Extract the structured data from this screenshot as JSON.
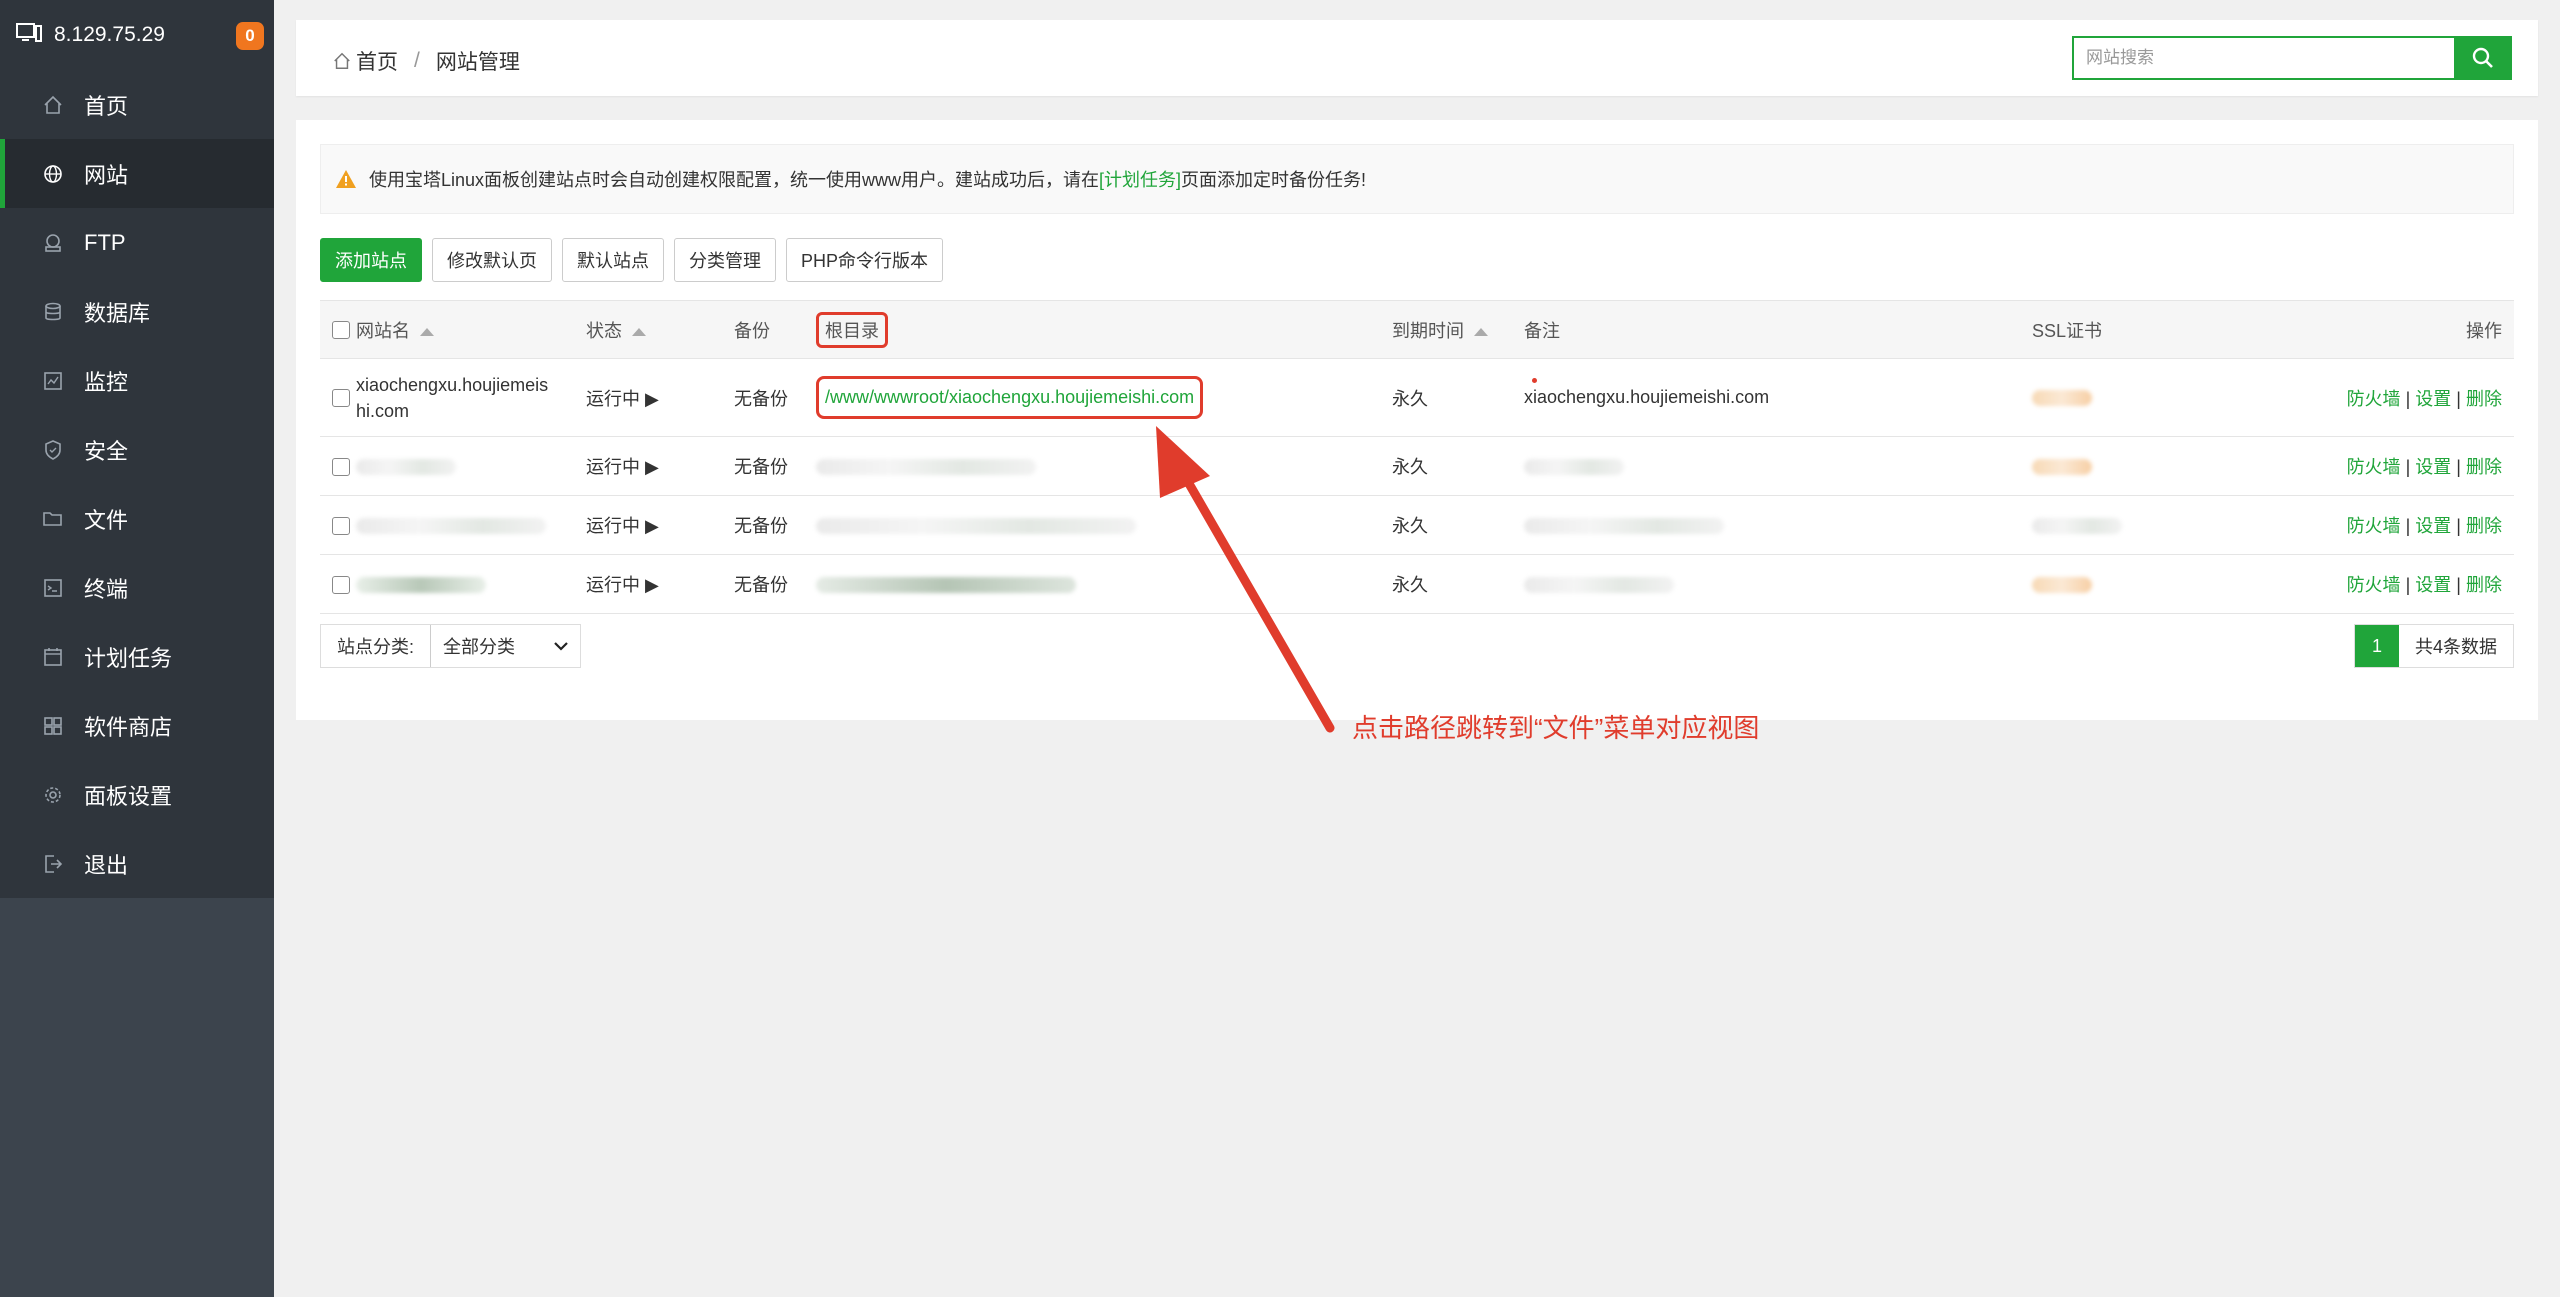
{
  "sidebar": {
    "server_ip": "8.129.75.29",
    "badge": "0",
    "items": [
      {
        "label": "首页",
        "icon": "home-icon"
      },
      {
        "label": "网站",
        "icon": "globe-icon"
      },
      {
        "label": "FTP",
        "icon": "ftp-icon"
      },
      {
        "label": "数据库",
        "icon": "database-icon"
      },
      {
        "label": "监控",
        "icon": "monitor-icon"
      },
      {
        "label": "安全",
        "icon": "shield-icon"
      },
      {
        "label": "文件",
        "icon": "folder-icon"
      },
      {
        "label": "终端",
        "icon": "terminal-icon"
      },
      {
        "label": "计划任务",
        "icon": "calendar-icon"
      },
      {
        "label": "软件商店",
        "icon": "apps-icon"
      },
      {
        "label": "面板设置",
        "icon": "gear-icon"
      },
      {
        "label": "退出",
        "icon": "logout-icon"
      }
    ],
    "active_index": 1
  },
  "header": {
    "breadcrumb_home": "首页",
    "breadcrumb_sep": "/",
    "breadcrumb_current": "网站管理",
    "search_placeholder": "网站搜索"
  },
  "notice": {
    "text_before": "使用宝塔Linux面板创建站点时会自动创建权限配置，统一使用www用户。建站成功后，请在",
    "link": "[计划任务]",
    "text_after": "页面添加定时备份任务!"
  },
  "toolbar": {
    "add_site": "添加站点",
    "modify_default_page": "修改默认页",
    "default_site": "默认站点",
    "category_manage": "分类管理",
    "php_cli": "PHP命令行版本"
  },
  "table": {
    "headers": {
      "name": "网站名",
      "status": "状态",
      "backup": "备份",
      "root": "根目录",
      "expire": "到期时间",
      "note": "备注",
      "ssl": "SSL证书",
      "ops": "操作"
    },
    "row1": {
      "name_line1": "xiaochengxu.houjiemeis",
      "name_line2": "hi.com",
      "status": "运行中 ▶",
      "backup": "无备份",
      "root": "/www/wwwroot/xiaochengxu.houjiemeishi.com",
      "expire": "永久",
      "note": "xiaochengxu.houjiemeishi.com"
    },
    "other_rows": [
      {
        "status": "运行中 ▶",
        "backup": "无备份",
        "expire": "永久"
      },
      {
        "status": "运行中 ▶",
        "backup": "无备份",
        "expire": "永久"
      },
      {
        "status": "运行中 ▶",
        "backup": "无备份",
        "expire": "永久"
      }
    ],
    "ops": {
      "firewall": "防火墙",
      "sep": "|",
      "settings": "设置",
      "delete": "删除"
    }
  },
  "footer": {
    "category_label": "站点分类:",
    "category_value": "全部分类",
    "page": "1",
    "total": "共4条数据"
  },
  "annotation": "点击路径跳转到“文件”菜单对应视图",
  "colors": {
    "accent": "#20a53a",
    "annotation": "#e03c2c",
    "sidebar": "#3c444d"
  }
}
